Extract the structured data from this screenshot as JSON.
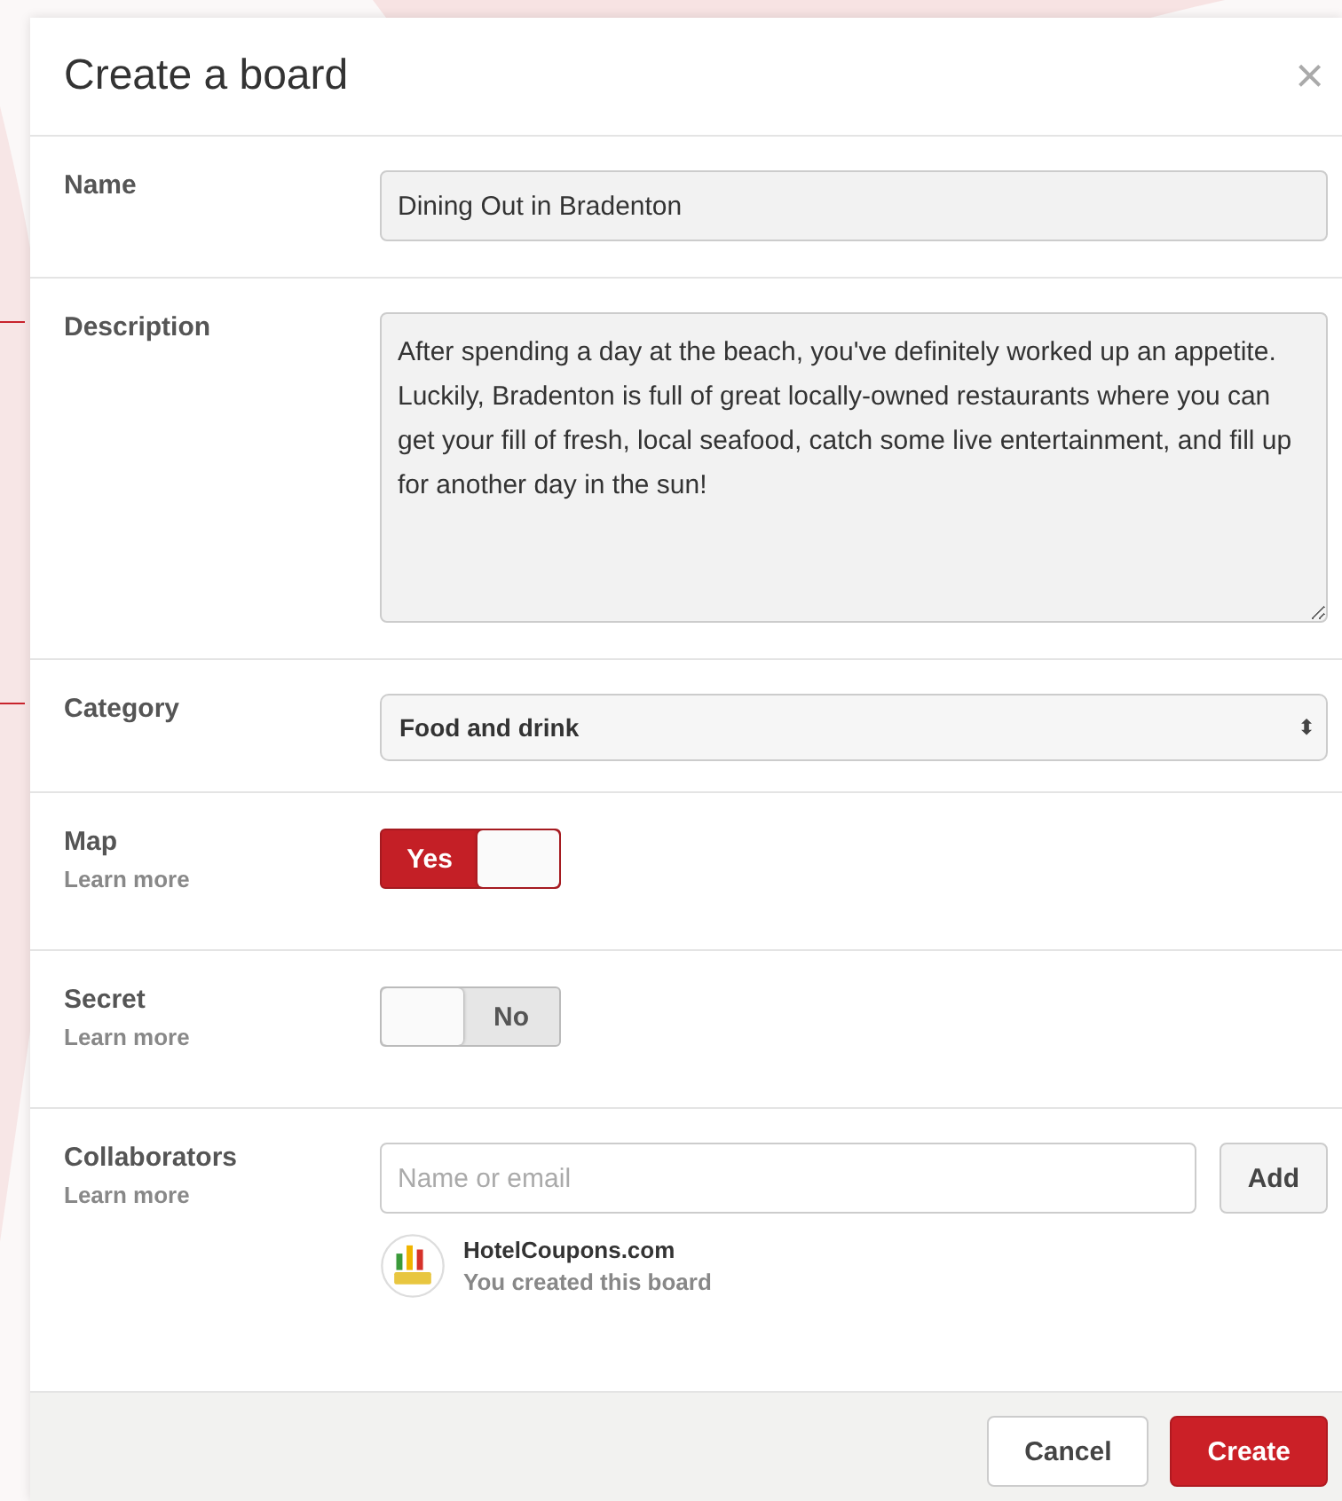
{
  "dialog": {
    "title": "Create a board",
    "close": "×"
  },
  "rows": [
    {
      "kind": "text",
      "label": "Name",
      "value": "Dining Out in Bradenton"
    },
    {
      "kind": "textarea",
      "label": "Description",
      "value": "After spending a day at the beach, you've definitely worked up an appetite. Luckily, Bradenton is full of great locally-owned restaurants where you can get your fill of fresh, local seafood, catch some live entertainment, and fill up for another day in the sun!",
      "leader": true
    },
    {
      "kind": "select",
      "label": "Category",
      "value": "Food and drink",
      "arrow": "⬍",
      "leader": true
    },
    {
      "kind": "toggle",
      "label": "Map",
      "link": "Learn more",
      "on": true,
      "text": "Yes"
    },
    {
      "kind": "toggle",
      "label": "Secret",
      "link": "Learn more",
      "on": false,
      "text": "No"
    },
    {
      "kind": "collaborators",
      "label": "Collaborators",
      "link": "Learn more",
      "placeholder": "Name or email",
      "button": "Add",
      "people": [
        {
          "name": "HotelCoupons.com",
          "note": "You created this board"
        }
      ]
    }
  ],
  "footer": {
    "buttons": [
      {
        "label": "Cancel",
        "primary": false
      },
      {
        "label": "Create",
        "primary": true
      }
    ]
  }
}
